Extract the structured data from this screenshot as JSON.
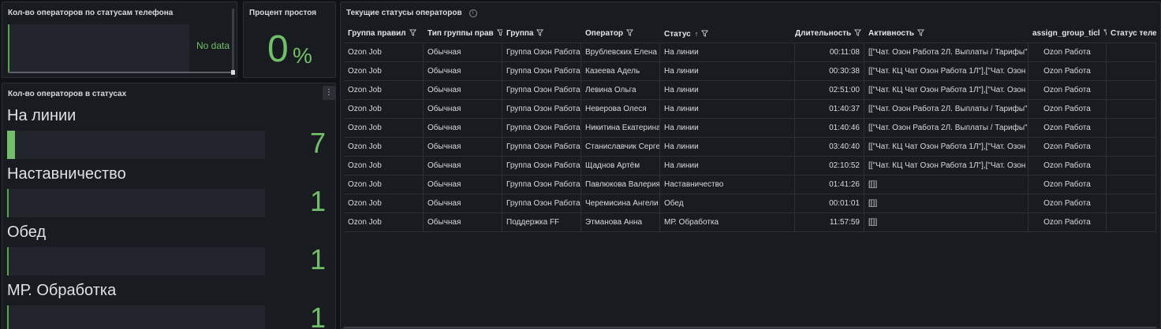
{
  "panel_phone": {
    "title": "Кол-во операторов по статусам телефона",
    "no_data": "No data"
  },
  "panel_idle": {
    "title": "Процент простоя",
    "value": "0",
    "unit": "%"
  },
  "panel_statuses": {
    "title": "Кол-во операторов в статусах",
    "menu_icon": "vertical-ellipsis-icon",
    "max_value": 7,
    "items": [
      {
        "label": "На линии",
        "value": "7",
        "fill": 1.0
      },
      {
        "label": "Наставничество",
        "value": "1",
        "fill": 0.14
      },
      {
        "label": "Обед",
        "value": "1",
        "fill": 0.14
      },
      {
        "label": "МР. Обработка",
        "value": "1",
        "fill": 0.14
      }
    ]
  },
  "panel_table": {
    "title": "Текущие статусы операторов",
    "info_icon": "info-circle-icon",
    "columns": [
      {
        "label": "Группа правил",
        "filter": true
      },
      {
        "label": "Тип группы прав",
        "filter": true
      },
      {
        "label": "Группа",
        "filter": true
      },
      {
        "label": "Оператор",
        "filter": true
      },
      {
        "label": "Статус",
        "filter": true,
        "sort": "asc"
      },
      {
        "label": "Длительность",
        "filter": true
      },
      {
        "label": "Активность",
        "filter": true
      },
      {
        "label": "assign_group_ticl",
        "filter": true
      },
      {
        "label": "Статус теле",
        "filter": false
      }
    ],
    "rows": [
      [
        "Ozon Job",
        "Обычная",
        "Группа Озон Работа",
        "Врублевских Елена",
        "На линии",
        "00:11:08",
        "[[\"Чат. Озон Работа 2Л. Выплаты / Тарифы\"",
        "Ozon Работа",
        ""
      ],
      [
        "Ozon Job",
        "Обычная",
        "Группа Озон Работа",
        "Казеева Адель",
        "На линии",
        "00:30:38",
        "[[\"Чат. КЦ Чат Озон Работа 1Л\"],[\"Чат. Озон",
        "Ozon Работа",
        ""
      ],
      [
        "Ozon Job",
        "Обычная",
        "Группа Озон Работа",
        "Левина Ольга",
        "На линии",
        "02:51:00",
        "[[\"Чат. КЦ Чат Озон Работа 1Л\"],[\"Чат. Озон",
        "Ozon Работа",
        ""
      ],
      [
        "Ozon Job",
        "Обычная",
        "Группа Озон Работа",
        "Неверова Олеся",
        "На линии",
        "01:40:37",
        "[[\"Чат. Озон Работа 2Л. Выплаты / Тарифы\"",
        "Ozon Работа",
        ""
      ],
      [
        "Ozon Job",
        "Обычная",
        "Группа Озон Работа",
        "Никитина Екатерина",
        "На линии",
        "01:40:46",
        "[[\"Чат. Озон Работа 2Л. Выплаты / Тарифы\"",
        "Ozon Работа",
        ""
      ],
      [
        "Ozon Job",
        "Обычная",
        "Группа Озон Работа",
        "Станиславчик Серге",
        "На линии",
        "03:40:40",
        "[[\"Чат. КЦ Чат Озон Работа 1Л\"],[\"Чат. Озон",
        "Ozon Работа",
        ""
      ],
      [
        "Ozon Job",
        "Обычная",
        "Группа Озон Работа",
        "Щаднов Артём",
        "На линии",
        "02:10:52",
        "[[\"Чат. КЦ Чат Озон Работа 1Л\"],[\"Чат. Озон",
        "Ozon Работа",
        ""
      ],
      [
        "Ozon Job",
        "Обычная",
        "Группа Озон Работа",
        "Павлюкова Валерия",
        "Наставничество",
        "01:41:26",
        "[[]]",
        "Ozon Работа",
        ""
      ],
      [
        "Ozon Job",
        "Обычная",
        "Группа Озон Работа",
        "Черемисина Ангели",
        "Обед",
        "00:01:01",
        "[[]]",
        "Ozon Работа",
        ""
      ],
      [
        "Ozon Job",
        "Обычная",
        "Поддержка FF",
        "Этманова Анна",
        "МР. Обработка",
        "11:57:59",
        "[[]]",
        "Ozon Работа",
        ""
      ]
    ]
  }
}
